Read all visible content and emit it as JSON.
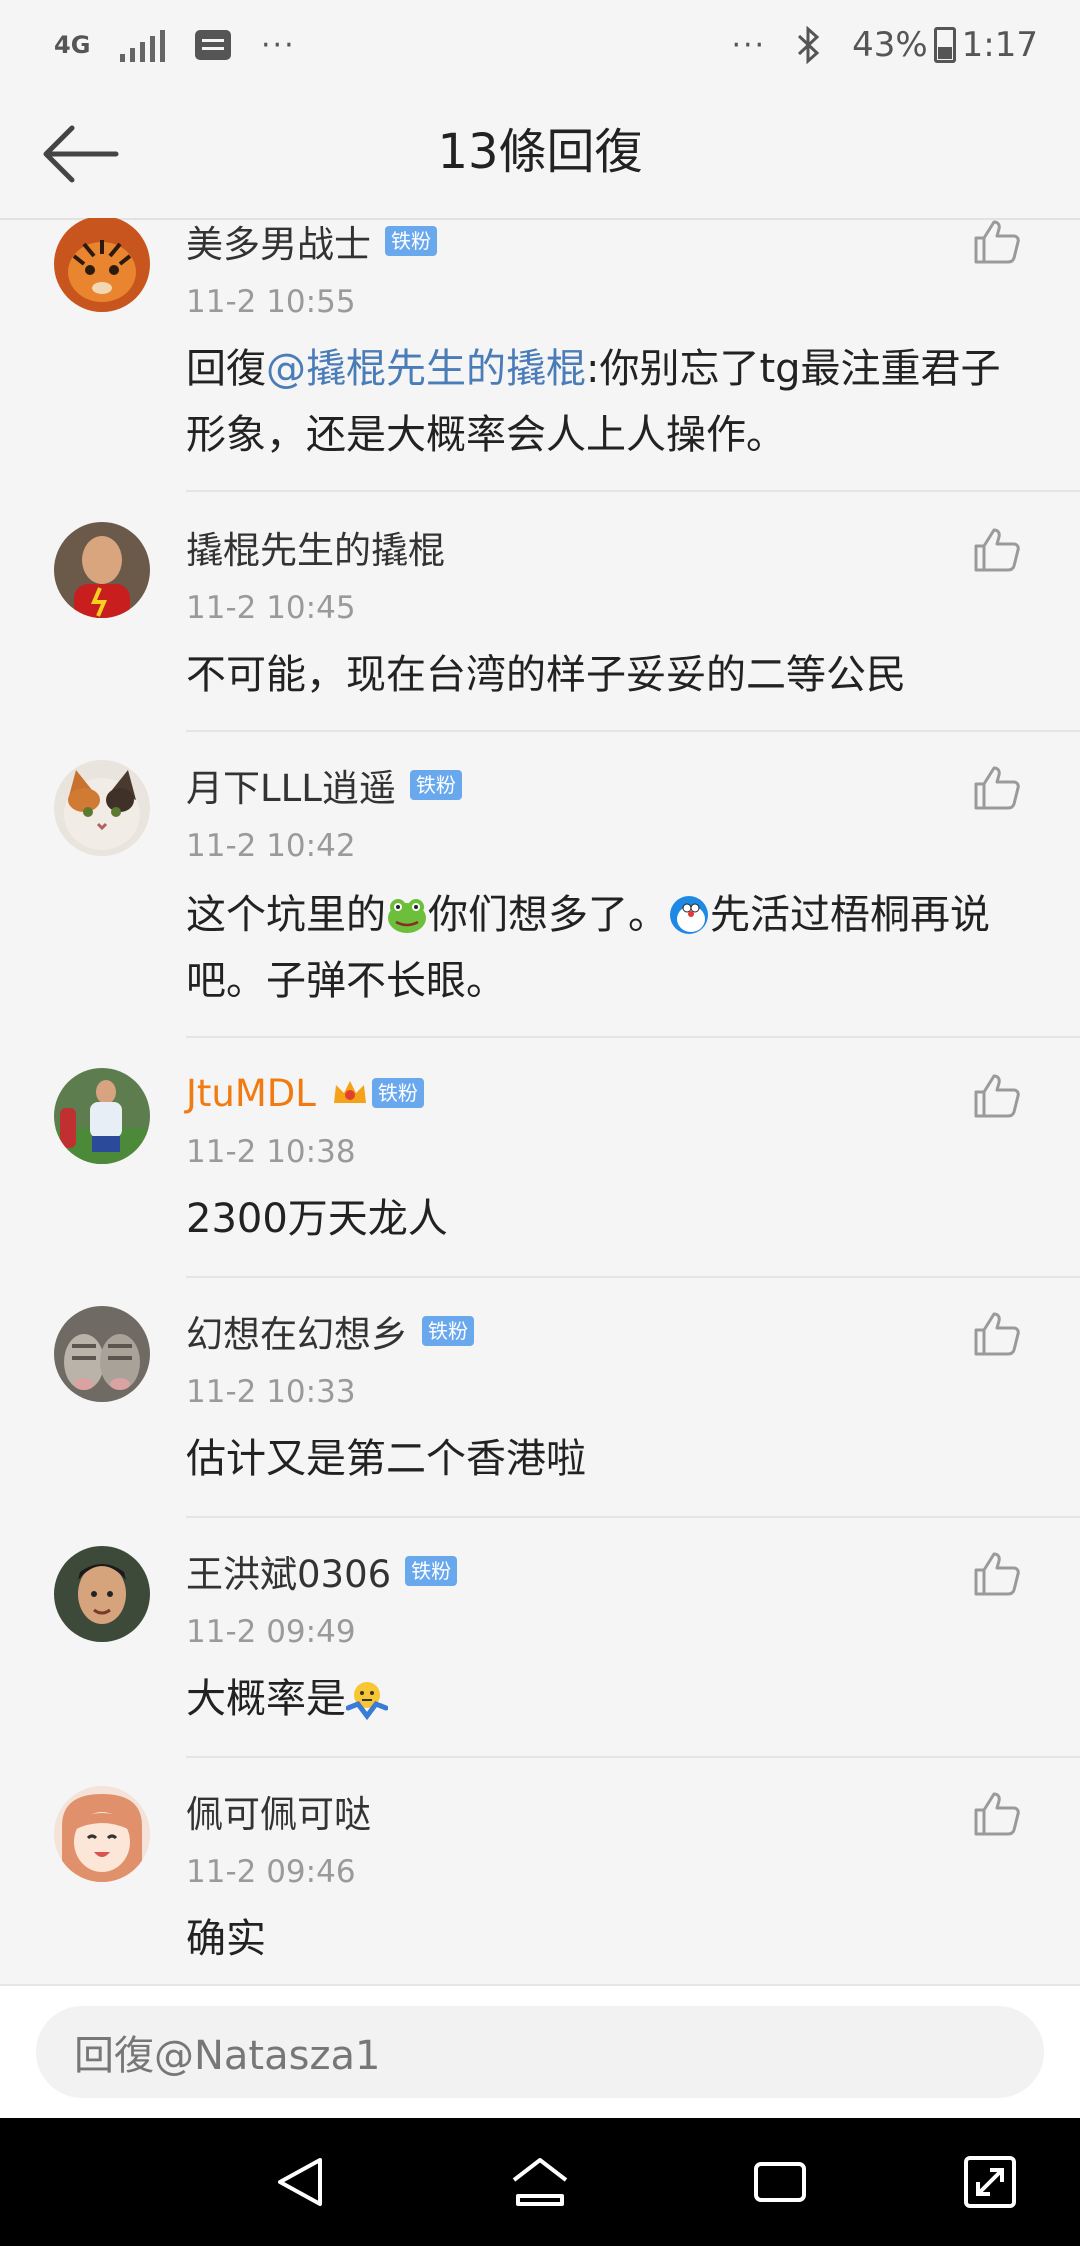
{
  "status_bar": {
    "network": "4G",
    "battery": "43%",
    "time": "1:17",
    "more_left": "···",
    "more_right": "···"
  },
  "header": {
    "title": "13條回復"
  },
  "comments": [
    {
      "username": "美多男战士",
      "badge": "铁粉",
      "time": "11-2 10:55",
      "reply_prefix": "回復",
      "mention": "@撬棍先生的撬棍",
      "text": ":你别忘了tg最注重君子形象，还是大概率会人上人操作。"
    },
    {
      "username": "撬棍先生的撬棍",
      "badge": "",
      "time": "11-2 10:45",
      "text": "不可能，现在台湾的样子妥妥的二等公民"
    },
    {
      "username": "月下LLL逍遥",
      "badge": "铁粉",
      "time": "11-2 10:42",
      "text_a": "这个坑里的",
      "text_b": "你们想多了。",
      "text_c": "先活过梧桐再说吧。子弹不长眼。"
    },
    {
      "username": "JtuMDL",
      "badge": "铁粉",
      "time": "11-2 10:38",
      "text": "2300万天龙人"
    },
    {
      "username": "幻想在幻想乡",
      "badge": "铁粉",
      "time": "11-2 10:33",
      "text": "估计又是第二个香港啦"
    },
    {
      "username": "王洪斌0306",
      "badge": "铁粉",
      "time": "11-2 09:49",
      "text": "大概率是"
    },
    {
      "username": "佩可佩可哒",
      "badge": "",
      "time": "11-2 09:46",
      "text": "确实"
    }
  ],
  "reply_bar": {
    "placeholder": "回復@Natasza1"
  },
  "colors": {
    "mention": "#4a7cb8",
    "vip_name": "#f07b12",
    "badge": "#6aa8ee"
  },
  "icons": [
    "back-arrow-icon",
    "thumbs-up-icon",
    "frog-emoji-icon",
    "doraemon-emoji-icon",
    "shrug-emoji-icon",
    "crown-icon"
  ]
}
